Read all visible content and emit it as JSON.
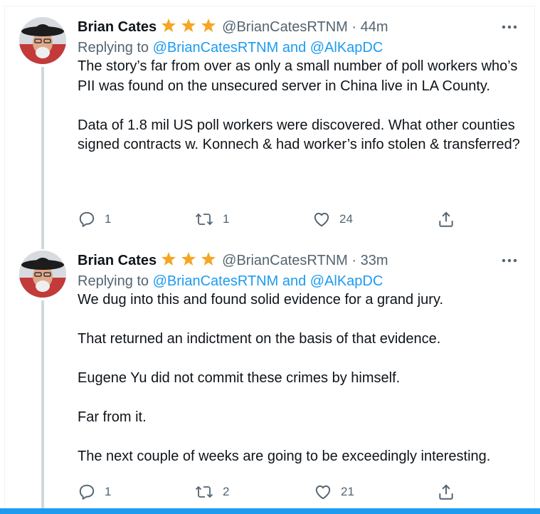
{
  "tweets": [
    {
      "name": "Brian Cates",
      "handle": "@BrianCatesRTNM",
      "dot": "·",
      "time": "44m",
      "replying_prefix": "Replying to",
      "replying_to": "@BrianCatesRTNM and @AlKapDC",
      "paragraphs": [
        "The story’s far from over as only a small number of poll workers who’s PII was found on the unsecured server in China live in LA County.",
        "Data of 1.8 mil US poll workers were discovered. What other counties signed contracts w. Konnech & had worker’s info stolen & transferred?"
      ],
      "replies": "1",
      "retweets": "1",
      "likes": "24"
    },
    {
      "name": "Brian Cates",
      "handle": "@BrianCatesRTNM",
      "dot": "·",
      "time": "33m",
      "replying_prefix": "Replying to",
      "replying_to": "@BrianCatesRTNM and @AlKapDC",
      "paragraphs": [
        "We dug into this and found solid evidence for a grand jury.",
        "That returned an indictment on the basis of that evidence.",
        "Eugene Yu did not commit these crimes by himself.",
        "Far from it.",
        "The next couple of weeks are going to be exceedingly interesting."
      ],
      "replies": "1",
      "retweets": "2",
      "likes": "21"
    }
  ],
  "icons": {
    "star": "star-icon",
    "more": "more-icon",
    "reply": "reply-icon",
    "retweet": "retweet-icon",
    "like": "heart-icon",
    "share": "share-icon"
  },
  "colors": {
    "accent": "#1d9bf0",
    "star": "#f5a623",
    "muted": "#536471",
    "text": "#0f1419"
  }
}
